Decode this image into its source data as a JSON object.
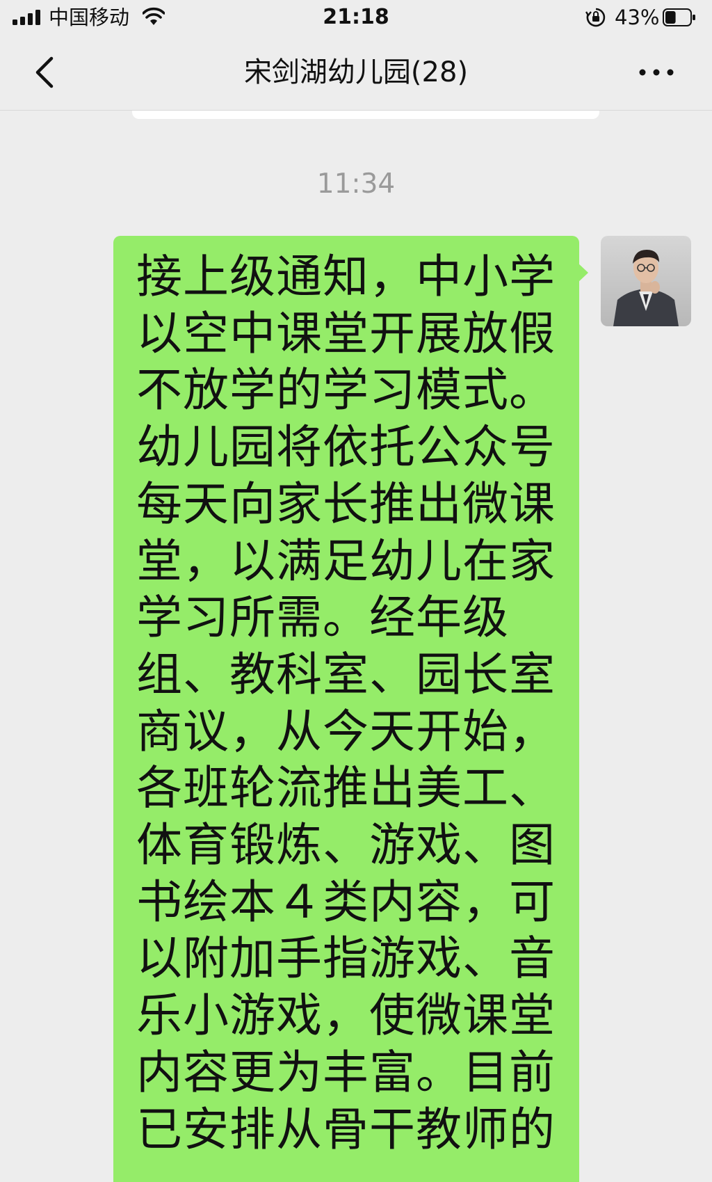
{
  "status_bar": {
    "carrier": "中国移动",
    "time": "21:18",
    "battery_percent": "43%",
    "battery_level": 0.43,
    "icons": [
      "signal-icon",
      "wifi-icon",
      "orientation-lock-icon",
      "battery-icon"
    ]
  },
  "nav": {
    "title": "宋剑湖幼儿园(28)",
    "back_icon": "chevron-left-icon",
    "more_icon": "more-dots-icon"
  },
  "chat": {
    "timestamp": "11:34",
    "message": {
      "lines": [
        "接上级通知，中小学",
        "以空中课堂开展放假",
        "不放学的学习模式。",
        "幼儿园将依托公众号",
        "每天向家长推出微课",
        "堂，以满足幼儿在家",
        "学习所需。经年级",
        "组、教科室、园长室",
        "商议，从今天开始，",
        "各班轮流推出美工、",
        "体育锻炼、游戏、图",
        "书绘本４类内容，可",
        "以附加手指游戏、音",
        "乐小游戏，使微课堂",
        "内容更为丰富。目前",
        "已安排从骨干教师的"
      ],
      "bubble_color": "#95ec69"
    }
  }
}
